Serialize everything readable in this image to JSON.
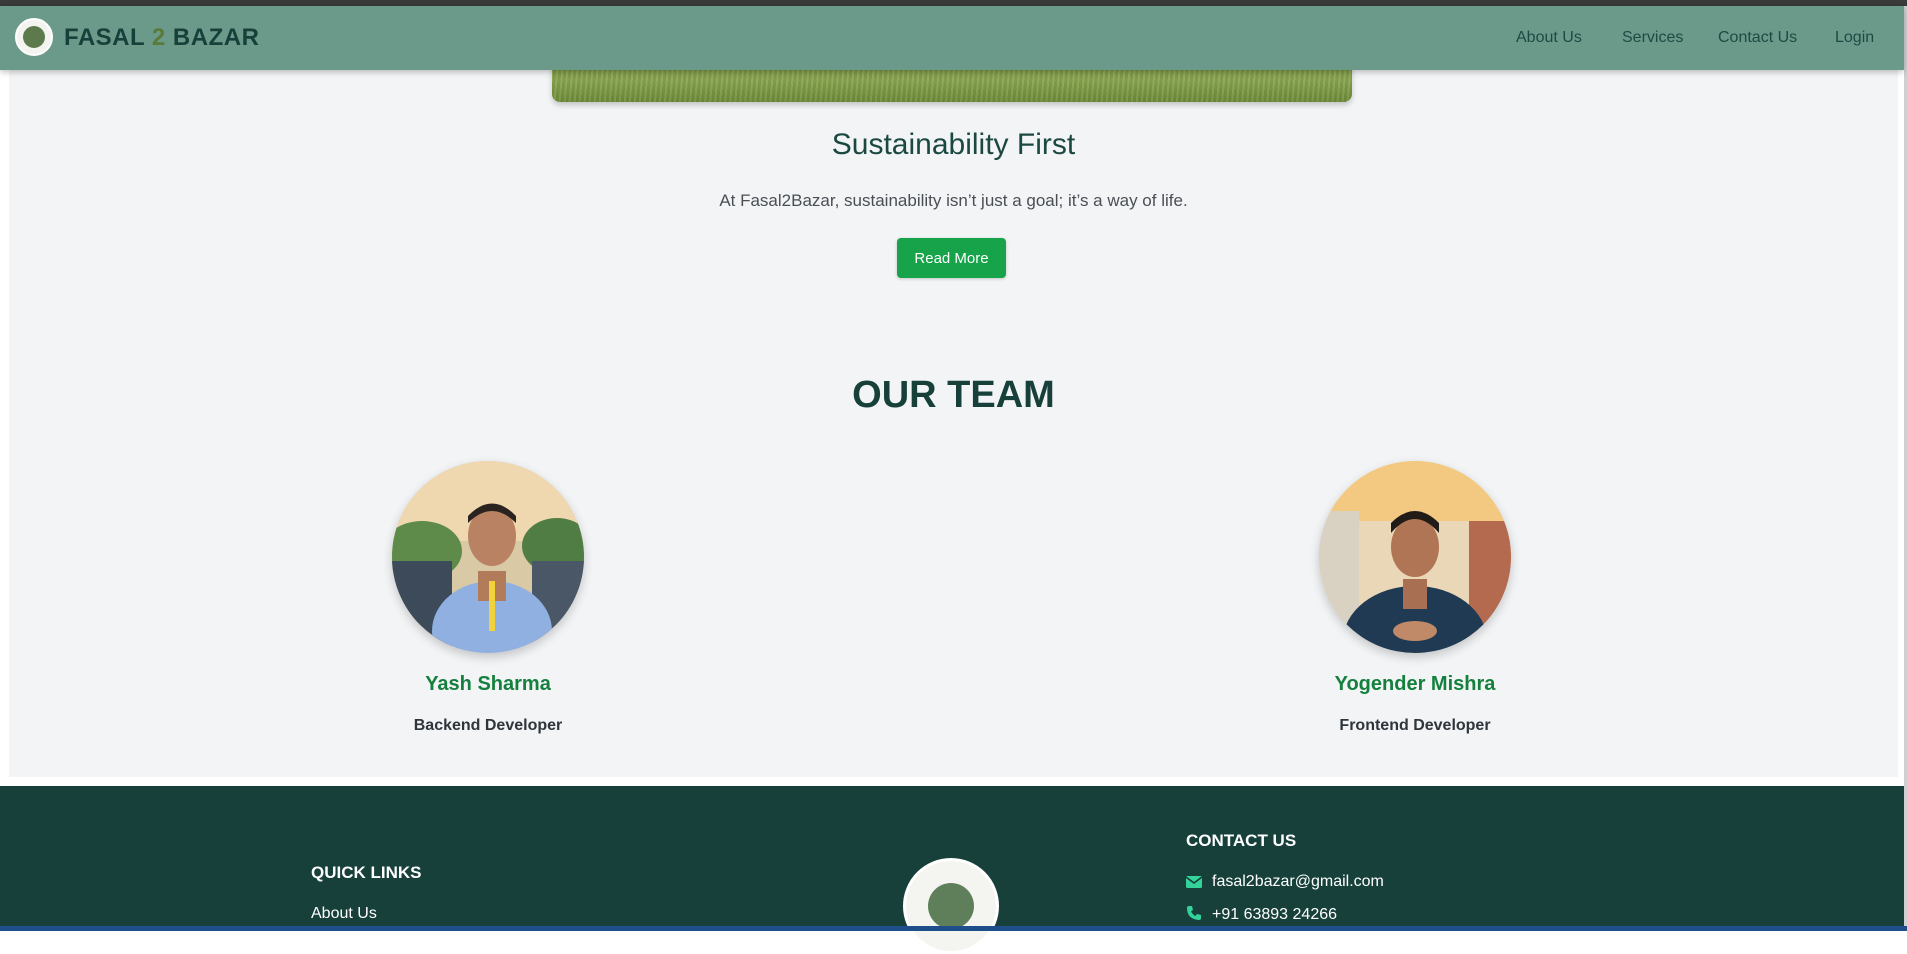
{
  "navbar": {
    "brand_part1": "FASAL ",
    "brand_num": "2",
    "brand_part2": " BAZAR",
    "links": [
      "About Us",
      "Services",
      "Contact Us",
      "Login"
    ]
  },
  "sustainability": {
    "title": "Sustainability First",
    "text": "At Fasal2Bazar, sustainability isn’t just a goal; it’s a way of life.",
    "button_label": "Read More"
  },
  "team": {
    "title": "OUR TEAM",
    "members": [
      {
        "name": "Yash Sharma",
        "role": "Backend Developer"
      },
      {
        "name": "Yogender Mishra",
        "role": "Frontend Developer"
      }
    ]
  },
  "footer": {
    "quick_links_heading": "QUICK LINKS",
    "quick_links": [
      "About Us"
    ],
    "contact_heading": "CONTACT US",
    "email": "fasal2bazar@gmail.com",
    "phone": "+91 63893 24266"
  },
  "colors": {
    "navbar": "#6c9a8a",
    "brand_dark": "#17403a",
    "accent_green": "#16a34a",
    "member_name": "#15803d",
    "footer_bg": "#17403a"
  },
  "icons": [
    "logo-icon",
    "envelope-icon",
    "phone-icon"
  ]
}
